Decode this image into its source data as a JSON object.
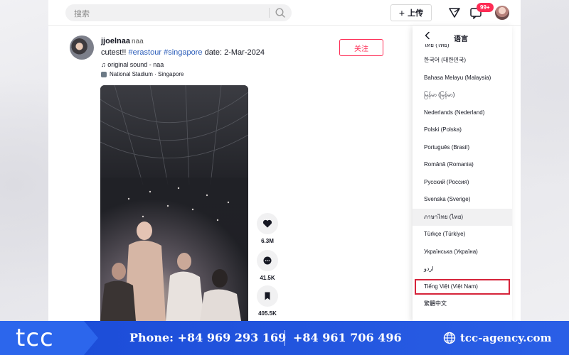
{
  "topbar": {
    "search_placeholder": "搜索",
    "upload_label": "上传",
    "inbox_badge": "99+"
  },
  "post": {
    "username": "jjoelnaa",
    "nickname": "naa",
    "caption_prefix": "cutest!! ",
    "hashtags": [
      "#erastour",
      "#singapore"
    ],
    "caption_suffix": " date: 2-Mar-2024",
    "sound": "♫ original sound - naa",
    "location": "National Stadium · Singapore",
    "follow_label": "关注"
  },
  "actions": {
    "likes": "6.3M",
    "comments": "41.5K",
    "saves": "405.5K"
  },
  "language_menu": {
    "title": "语言",
    "items": [
      {
        "label": "ไทย (ไทย)",
        "state": "cut"
      },
      {
        "label": "한국어 (대한민국)",
        "state": "normal"
      },
      {
        "label": "Bahasa Melayu (Malaysia)",
        "state": "normal"
      },
      {
        "label": "မြန်မာ (မြန်မာ)",
        "state": "normal"
      },
      {
        "label": "Nederlands (Nederland)",
        "state": "normal"
      },
      {
        "label": "Polski (Polska)",
        "state": "normal"
      },
      {
        "label": "Português (Brasil)",
        "state": "normal"
      },
      {
        "label": "Română (Romania)",
        "state": "normal"
      },
      {
        "label": "Русский (Россия)",
        "state": "normal"
      },
      {
        "label": "Svenska (Sverige)",
        "state": "normal"
      },
      {
        "label": "ภาษาไทย (ไทย)",
        "state": "highlight"
      },
      {
        "label": "Türkçe (Türkiye)",
        "state": "normal"
      },
      {
        "label": "Українська (Україна)",
        "state": "normal"
      },
      {
        "label": "اردو",
        "state": "normal"
      },
      {
        "label": "Tiếng Việt (Việt Nam)",
        "state": "selected"
      },
      {
        "label": "繁體中文",
        "state": "normal"
      }
    ]
  },
  "footer": {
    "logo": "tcc",
    "phone": "Phone: +84 969 293 169",
    "phone2": "+84 961 706 496",
    "website": "tcc-agency.com"
  },
  "colors": {
    "accent": "#fe2c55",
    "hashtag": "#2b5db9",
    "highlight_outline": "#d6243a",
    "footer_blue": "#1a4ad6"
  }
}
